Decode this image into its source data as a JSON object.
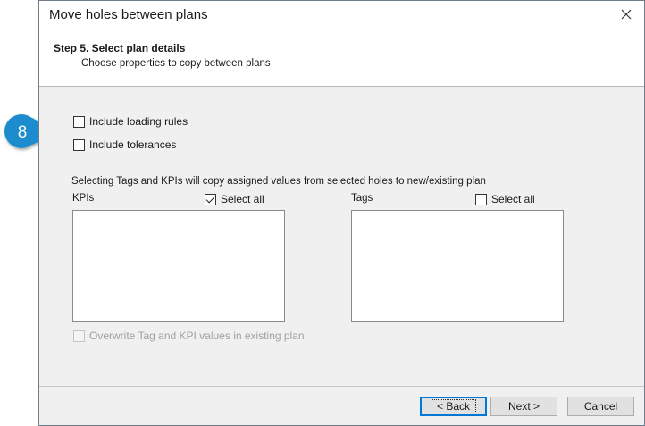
{
  "window": {
    "title": "Move holes between plans"
  },
  "header": {
    "step_title": "Step 5. Select plan details",
    "step_subtitle": "Choose properties to copy between plans"
  },
  "options": {
    "include_loading_rules": {
      "label": "Include loading rules",
      "checked": false
    },
    "include_tolerances": {
      "label": "Include tolerances",
      "checked": false
    }
  },
  "info_text": "Selecting Tags and KPIs will copy assigned values from selected holes to new/existing plan",
  "kpis": {
    "label": "KPIs",
    "select_all_label": "Select all",
    "select_all_checked": true,
    "items": []
  },
  "tags": {
    "label": "Tags",
    "select_all_label": "Select all",
    "select_all_checked": false,
    "items": []
  },
  "overwrite": {
    "label": "Overwrite Tag and KPI values in existing plan",
    "checked": false,
    "enabled": false
  },
  "buttons": {
    "back": "< Back",
    "next": "Next >",
    "cancel": "Cancel"
  },
  "callout": {
    "number": "8",
    "color": "#1a8ccf"
  }
}
